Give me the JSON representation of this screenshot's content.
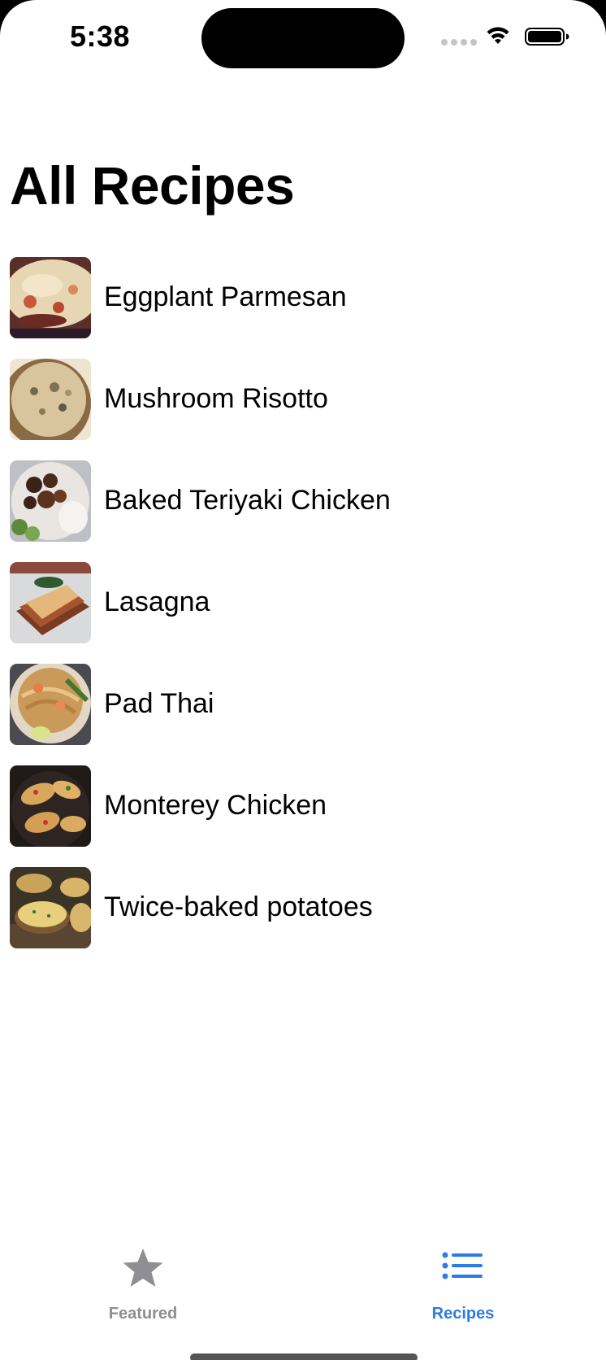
{
  "status_bar": {
    "time": "5:38",
    "signal_icon": "signal-dots-icon",
    "wifi_icon": "wifi-icon",
    "battery_icon": "battery-full-icon"
  },
  "header": {
    "title": "All Recipes"
  },
  "recipes": [
    {
      "name": "Eggplant Parmesan",
      "image": "eggplant-parmesan-photo"
    },
    {
      "name": "Mushroom Risotto",
      "image": "mushroom-risotto-photo"
    },
    {
      "name": "Baked Teriyaki Chicken",
      "image": "baked-teriyaki-chicken-photo"
    },
    {
      "name": "Lasagna",
      "image": "lasagna-photo"
    },
    {
      "name": "Pad Thai",
      "image": "pad-thai-photo"
    },
    {
      "name": "Monterey Chicken",
      "image": "monterey-chicken-photo"
    },
    {
      "name": "Twice-baked potatoes",
      "image": "twice-baked-potatoes-photo"
    }
  ],
  "tab_bar": {
    "tabs": [
      {
        "label": "Featured",
        "icon": "star-icon",
        "selected": false
      },
      {
        "label": "Recipes",
        "icon": "list-bullet-icon",
        "selected": true
      }
    ],
    "active_color": "#2f7be5",
    "inactive_color": "#8e8e93"
  }
}
